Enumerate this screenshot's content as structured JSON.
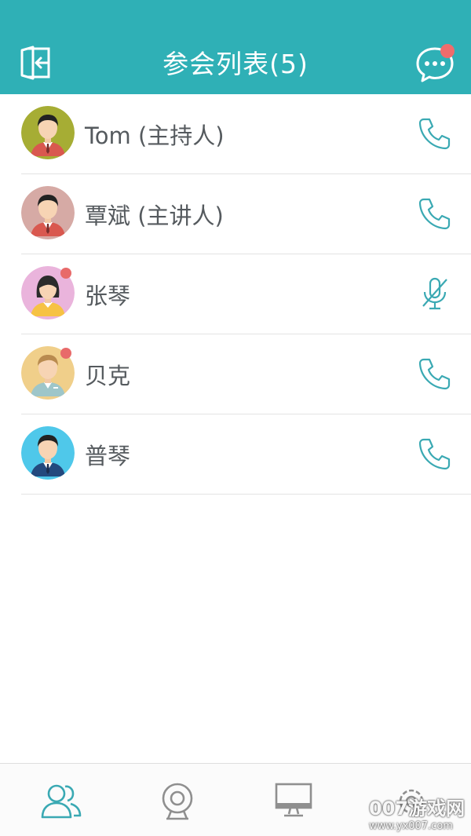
{
  "header": {
    "title": "参会列表(5)",
    "exit_icon": "exit-icon",
    "chat_icon": "chat-bubble-icon",
    "chat_has_notification": true
  },
  "participants": [
    {
      "name": "Tom (主持人)",
      "action_icon": "phone-icon",
      "status_dot": false
    },
    {
      "name": "覃斌 (主讲人)",
      "action_icon": "phone-icon",
      "status_dot": false
    },
    {
      "name": "张琴",
      "action_icon": "mic-off-icon",
      "status_dot": true
    },
    {
      "name": "贝克",
      "action_icon": "phone-icon",
      "status_dot": true
    },
    {
      "name": "普琴",
      "action_icon": "phone-icon",
      "status_dot": false
    }
  ],
  "tabbar": {
    "tabs": [
      {
        "icon": "participants-icon",
        "active": true
      },
      {
        "icon": "camera-icon",
        "active": false
      },
      {
        "icon": "screen-share-icon",
        "active": false
      },
      {
        "icon": "settings-icon",
        "active": false
      }
    ]
  },
  "watermark": {
    "line1": "007游戏网",
    "line2": "www.yx007.com"
  },
  "colors": {
    "accent": "#2fb0b6",
    "icon_teal": "#3aa9b3",
    "badge_red": "#ef6c6c",
    "inactive_icon": "#8f8f8f"
  }
}
